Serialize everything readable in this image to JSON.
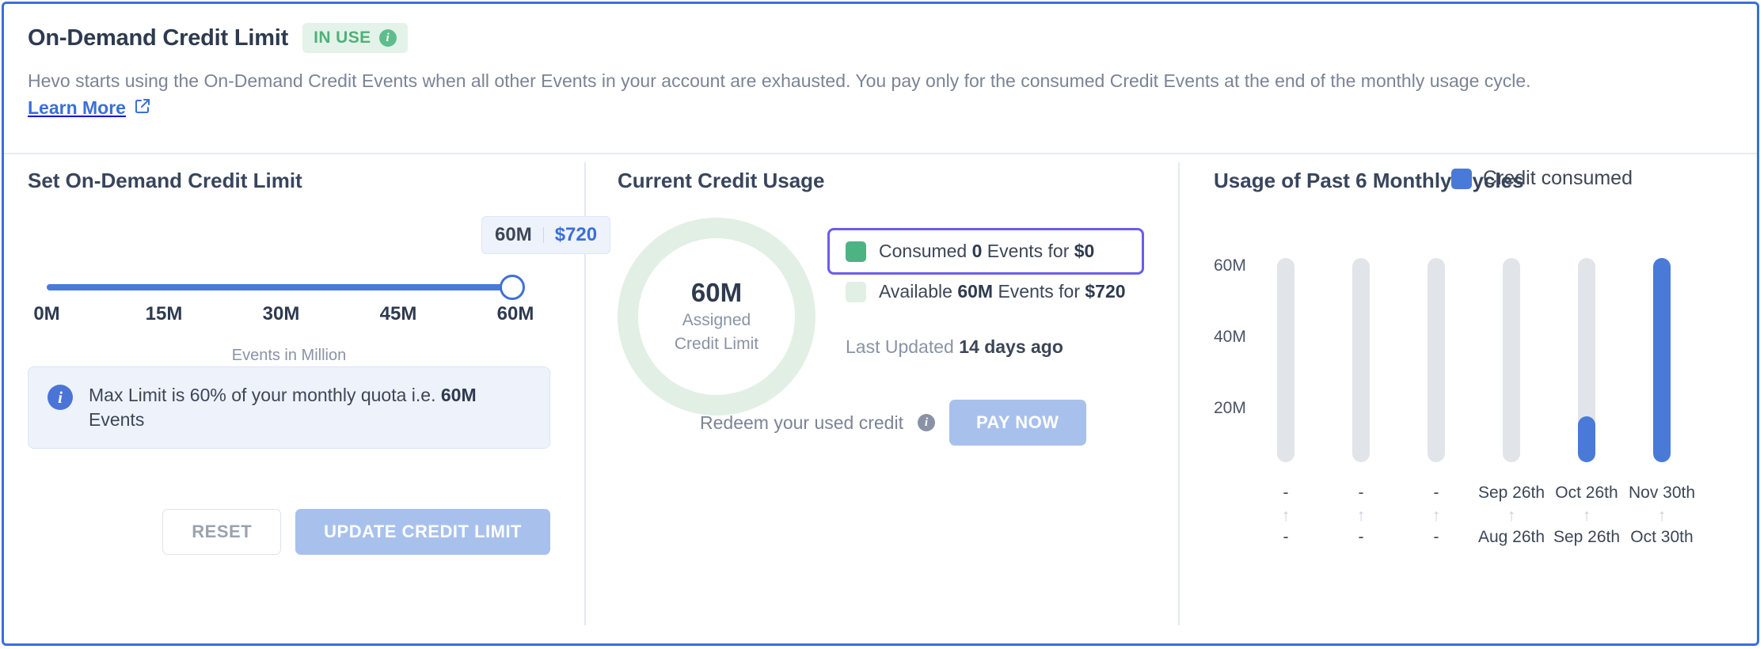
{
  "header": {
    "title": "On-Demand Credit Limit",
    "badge_label": "IN USE",
    "badge_info_icon": "info-icon",
    "description": "Hevo starts using the On-Demand Credit Events when all other Events in your account are exhausted. You pay only for the consumed Credit Events at the end of the monthly usage cycle.",
    "learn_more_label": "Learn More",
    "external_link_icon": "external-link-icon",
    "border_color": "#3a6fd8",
    "badge_color": "#4fb07a"
  },
  "set_limit": {
    "title": "Set On-Demand Credit Limit",
    "tooltip_value": "60M",
    "tooltip_price": "$720",
    "slider_value": 60,
    "slider_min": 0,
    "slider_max": 60,
    "ticks": [
      "0M",
      "15M",
      "30M",
      "45M",
      "60M"
    ],
    "axis_caption": "Events in Million",
    "info_icon": "info-icon",
    "info_text_prefix": "Max Limit is 60% of your monthly quota i.e. ",
    "info_text_bold": "60M",
    "info_text_suffix": " Events",
    "reset_label": "RESET",
    "update_label": "UPDATE CREDIT LIMIT",
    "accent_color": "#4a7ad8"
  },
  "credit_usage": {
    "title": "Current Credit Usage",
    "donut_value": "60M",
    "donut_label_line1": "Assigned",
    "donut_label_line2": "Credit Limit",
    "donut_color": "#e2efe5",
    "consumed": {
      "swatch_color": "#4cb383",
      "prefix": "Consumed ",
      "events": "0",
      "middle": " Events for ",
      "amount": "$0",
      "highlight_color": "#6b5cf0"
    },
    "available": {
      "swatch_color": "#e2efe5",
      "prefix": "Available ",
      "events": "60M",
      "middle": " Events for ",
      "amount": "$720"
    },
    "last_updated_label": "Last Updated ",
    "last_updated_value": "14 days ago",
    "redeem_label": "Redeem your used credit",
    "redeem_info_icon": "info-icon",
    "pay_now_label": "PAY NOW"
  },
  "chart_data": {
    "type": "bar",
    "title": "Usage of Past 6 Monthly Cycles",
    "legend": [
      {
        "name": "Credit consumed",
        "color": "#4a7ad8"
      }
    ],
    "legend_position": "top-right",
    "xlabel": "",
    "ylabel": "",
    "ylim": [
      0,
      67
    ],
    "yticks": [
      "20M",
      "40M",
      "60M"
    ],
    "ytick_values": [
      20,
      40,
      60
    ],
    "grid": false,
    "track_color": "#e1e4e9",
    "track_max": 67,
    "categories": [
      "-",
      "-",
      "-",
      "Sep 26th",
      "Oct 26th",
      "Nov 30th"
    ],
    "period_start": [
      "-",
      "-",
      "-",
      "Aug 26th",
      "Sep 26th",
      "Oct 30th"
    ],
    "arrow_glyph": "↑",
    "values": [
      0,
      0,
      0,
      0,
      15,
      67
    ]
  }
}
